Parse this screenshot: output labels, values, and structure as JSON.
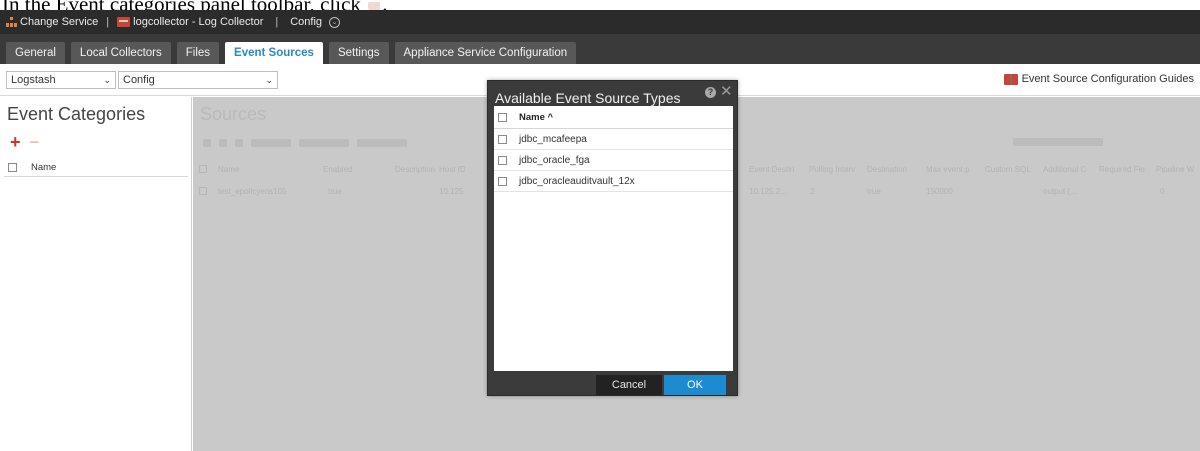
{
  "caption": {
    "text_before_icon": "In the Event categories panel toolbar, click",
    "text_after_icon": "."
  },
  "topbar": {
    "change_service": "Change Service",
    "service_name": "logcollector - Log Collector",
    "config": "Config"
  },
  "tabs": [
    {
      "label": "General",
      "active": false
    },
    {
      "label": "Local Collectors",
      "active": false
    },
    {
      "label": "Files",
      "active": false
    },
    {
      "label": "Event Sources",
      "active": true
    },
    {
      "label": "Settings",
      "active": false
    },
    {
      "label": "Appliance Service Configuration",
      "active": false
    }
  ],
  "dropdowns": {
    "collector": "Logstash",
    "mode": "Config"
  },
  "guides_link": "Event Source Configuration Guides",
  "left_panel": {
    "title": "Event Categories",
    "add_symbol": "+",
    "remove_symbol": "−",
    "column_header": "Name"
  },
  "sources": {
    "title": "Sources",
    "columns": [
      "Name",
      "Enabled",
      "Description",
      "Host ID",
      "Event Destin",
      "Polling Interv",
      "Destination",
      "Max event p",
      "Custom SQL",
      "Additional C",
      "Required Fie",
      "Pipeline W"
    ],
    "row": {
      "name": "test_epolicyens105",
      "enabled": "true",
      "host": "10.125",
      "event_dest": "10.125.2...",
      "polling": "2",
      "destination": "true",
      "max_events": "150000",
      "additional": "output {...",
      "pipeline": "0"
    }
  },
  "modal": {
    "title": "Available Event Source Types",
    "help_symbol": "?",
    "close_symbol": "✕",
    "header": "Name ^",
    "items": [
      "jdbc_mcafeepa",
      "jdbc_oracle_fga",
      "jdbc_oracleauditvault_12x"
    ],
    "cancel_label": "Cancel",
    "ok_label": "OK"
  },
  "colors": {
    "accent": "#1d8bd1",
    "active_tab_text": "#2b88c8",
    "add_red": "#cc3333",
    "topbar": "#2b2b2b"
  }
}
